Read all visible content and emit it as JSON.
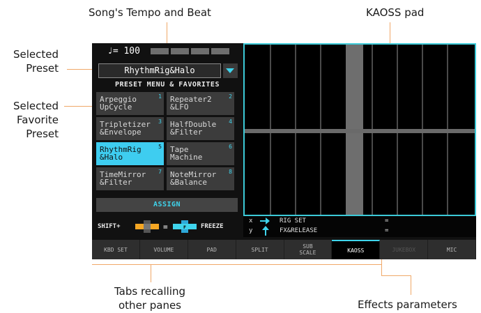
{
  "callouts": {
    "tempo_beat": "Song's Tempo and Beat",
    "kaoss_pad": "KAOSS pad",
    "selected_preset": [
      "Selected",
      "Preset"
    ],
    "selected_favorite_preset": [
      "Selected",
      "Favorite",
      "Preset"
    ],
    "tabs_recalling": [
      "Tabs recalling",
      "other panes"
    ],
    "effects_parameters": "Effects parameters"
  },
  "tempo": {
    "text": "♩= 100"
  },
  "preset": {
    "selected": "RhythmRig&Halo",
    "menu_title": "PRESET MENU & FAVORITES"
  },
  "favorites": [
    {
      "num": "1",
      "line1": "Arpeggio",
      "line2": "UpCycle",
      "selected": false
    },
    {
      "num": "2",
      "line1": "Repeater2",
      "line2": "&LFO",
      "selected": false
    },
    {
      "num": "3",
      "line1": "Tripletizer",
      "line2": "&Envelope",
      "selected": false
    },
    {
      "num": "4",
      "line1": "HalfDouble",
      "line2": "&Filter",
      "selected": false
    },
    {
      "num": "5",
      "line1": "RhythmRig",
      "line2": "&Halo",
      "selected": true
    },
    {
      "num": "6",
      "line1": "Tape",
      "line2": "Machine",
      "selected": false
    },
    {
      "num": "7",
      "line1": "TimeMirror",
      "line2": "&Filter",
      "selected": false
    },
    {
      "num": "8",
      "line1": "NoteMirror",
      "line2": "&Balance",
      "selected": false
    }
  ],
  "assign_label": "ASSIGN",
  "shift": {
    "prefix": "SHIFT+",
    "equals": "=",
    "freeze": "FREEZE"
  },
  "params": {
    "x_axis": "x",
    "y_axis": "y",
    "x_name": "RIG SET",
    "y_name": "FX&RELEASE",
    "x_value": "=",
    "y_value": "="
  },
  "tabs": [
    {
      "label": "KBD SET",
      "label2": "",
      "state": "normal"
    },
    {
      "label": "VOLUME",
      "label2": "",
      "state": "normal"
    },
    {
      "label": "PAD",
      "label2": "",
      "state": "normal"
    },
    {
      "label": "SPLIT",
      "label2": "",
      "state": "normal"
    },
    {
      "label": "SUB",
      "label2": "SCALE",
      "state": "normal"
    },
    {
      "label": "KAOSS",
      "label2": "",
      "state": "active"
    },
    {
      "label": "JUKEBOX",
      "label2": "",
      "state": "dim"
    },
    {
      "label": "MIC",
      "label2": "",
      "state": "normal"
    }
  ],
  "colors": {
    "accent": "#3fd4ec",
    "callout_line": "#f0a868",
    "selected_fav": "#3ecdf0"
  }
}
